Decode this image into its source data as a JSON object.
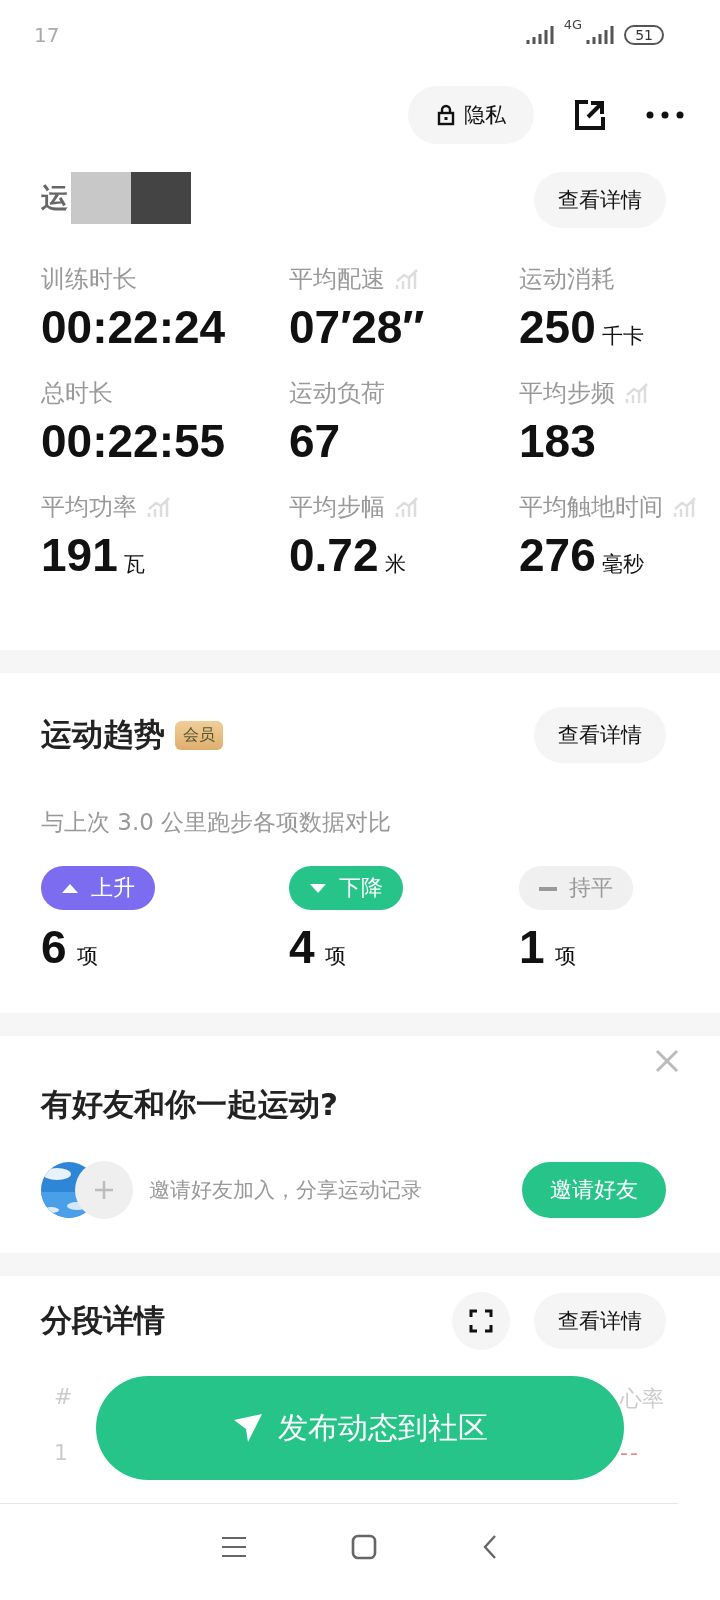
{
  "status_bar": {
    "time": "17",
    "network": "4G",
    "battery": "51"
  },
  "top_bar": {
    "privacy_button": "隐私"
  },
  "sport_data": {
    "title": "运",
    "detail_button": "查看详情",
    "stats": [
      {
        "label": "训练时长",
        "value": "00:22:24",
        "trend_icon": false
      },
      {
        "label": "平均配速",
        "value": "07′28″",
        "trend_icon": true
      },
      {
        "label": "运动消耗",
        "value": "250",
        "unit": "千卡",
        "trend_icon": false
      },
      {
        "label": "总时长",
        "value": "00:22:55",
        "trend_icon": false
      },
      {
        "label": "运动负荷",
        "value": "67",
        "trend_icon": false
      },
      {
        "label": "平均步频",
        "value": "183",
        "trend_icon": true
      },
      {
        "label": "平均功率",
        "value": "191",
        "unit": "瓦",
        "trend_icon": true
      },
      {
        "label": "平均步幅",
        "value": "0.72",
        "unit": "米",
        "trend_icon": true
      },
      {
        "label": "平均触地时间",
        "value": "276",
        "unit": "毫秒",
        "trend_icon": true
      }
    ]
  },
  "trend": {
    "title": "运动趋势",
    "badge": "会员",
    "detail_button": "查看详情",
    "subtitle": "与上次 3.0 公里跑步各项数据对比",
    "groups": [
      {
        "kind": "up",
        "label": "上升",
        "count": "6",
        "unit": "项"
      },
      {
        "kind": "down",
        "label": "下降",
        "count": "4",
        "unit": "项"
      },
      {
        "kind": "flat",
        "label": "持平",
        "count": "1",
        "unit": "项"
      }
    ]
  },
  "friends": {
    "title": "有好友和你一起运动?",
    "text": "邀请好友加入，分享运动记录",
    "invite_button": "邀请好友"
  },
  "segments": {
    "title": "分段详情",
    "detail_button": "查看详情",
    "columns": [
      "#",
      "心率"
    ],
    "rows": [
      [
        "1",
        "--"
      ]
    ]
  },
  "post_button": "发布动态到社区"
}
